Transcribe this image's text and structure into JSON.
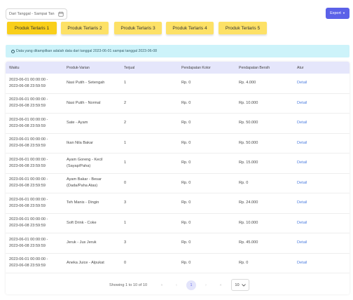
{
  "filter": {
    "placeholder": "Dari Tanggal - Sampai Tan"
  },
  "export": {
    "label": "Export"
  },
  "tabs": [
    {
      "label": "Produk Terlaris 1"
    },
    {
      "label": "Produk Terlaris 2"
    },
    {
      "label": "Produk Terlaris 3"
    },
    {
      "label": "Produk Terlaris 4"
    },
    {
      "label": "Produk Terlaris 5"
    }
  ],
  "info": {
    "text": "Data yang ditampilkan adalah data dari tanggal 2023-06-01 sampai tanggal 2023-06-08"
  },
  "table": {
    "headers": [
      "Waktu",
      "Produk-Varian",
      "Terjual",
      "Pendapatan Kotor",
      "Pendapatan Bersih",
      "Atur"
    ],
    "rows": [
      {
        "time_from": "2023-06-01 00:00:00 -",
        "time_to": "2023-06-08 23:59:59",
        "product": "Nasi Putih - Setengah",
        "product_2": "",
        "sold": "1",
        "gross": "Rp. 0",
        "net": "Rp. 4.000",
        "action": "Detail"
      },
      {
        "time_from": "2023-06-01 00:00:00 -",
        "time_to": "2023-06-08 23:59:59",
        "product": "Nasi Putih - Normal",
        "product_2": "",
        "sold": "2",
        "gross": "Rp. 0",
        "net": "Rp. 10.000",
        "action": "Detail"
      },
      {
        "time_from": "2023-06-01 00:00:00 -",
        "time_to": "2023-06-08 23:59:59",
        "product": "Sate - Ayam",
        "product_2": "",
        "sold": "2",
        "gross": "Rp. 0",
        "net": "Rp. 50.000",
        "action": "Detail"
      },
      {
        "time_from": "2023-06-01 00:00:00 -",
        "time_to": "2023-06-08 23:59:59",
        "product": "Ikan Nila Bakar",
        "product_2": "",
        "sold": "1",
        "gross": "Rp. 0",
        "net": "Rp. 50.000",
        "action": "Detail"
      },
      {
        "time_from": "2023-06-01 00:00:00 -",
        "time_to": "2023-06-08 23:59:59",
        "product": "Ayam Goreng - Kecil",
        "product_2": "(Sayap/Paha)",
        "sold": "1",
        "gross": "Rp. 0",
        "net": "Rp. 15.000",
        "action": "Detail"
      },
      {
        "time_from": "2023-06-01 00:00:00 -",
        "time_to": "2023-06-08 23:59:59",
        "product": "Ayam Bakar - Besar",
        "product_2": "(Dada/Paha Atas)",
        "sold": "0",
        "gross": "Rp. 0",
        "net": "Rp. 0",
        "action": "Detail"
      },
      {
        "time_from": "2023-06-01 00:00:00 -",
        "time_to": "2023-06-08 23:59:59",
        "product": "Teh Manis - Dingin",
        "product_2": "",
        "sold": "3",
        "gross": "Rp. 0",
        "net": "Rp. 24.000",
        "action": "Detail"
      },
      {
        "time_from": "2023-06-01 00:00:00 -",
        "time_to": "2023-06-08 23:59:59",
        "product": "Soft Drink - Coke",
        "product_2": "",
        "sold": "1",
        "gross": "Rp. 0",
        "net": "Rp. 10.000",
        "action": "Detail"
      },
      {
        "time_from": "2023-06-01 00:00:00 -",
        "time_to": "2023-06-08 23:59:59",
        "product": "Jeruk - Jus Jeruk",
        "product_2": "",
        "sold": "3",
        "gross": "Rp. 0",
        "net": "Rp. 45.000",
        "action": "Detail"
      },
      {
        "time_from": "2023-06-01 00:00:00 -",
        "time_to": "2023-06-08 23:59:59",
        "product": "Aneka Juice - Alpukat",
        "product_2": "",
        "sold": "0",
        "gross": "Rp. 0",
        "net": "Rp. 0",
        "action": "Detail"
      }
    ]
  },
  "pagination": {
    "summary": "Showing 1 to 10 of 10",
    "first": "«",
    "prev": "‹",
    "page": "1",
    "next": "›",
    "last": "»",
    "per_page": "10"
  },
  "colors": {
    "accent": "#5b61e8",
    "tab": "#fde166",
    "tab_active": "#f9cf1a",
    "banner": "#cdf3fa",
    "link": "#4f7fe0"
  },
  "icons": {
    "filter": "calendar-icon",
    "banner": "info-icon",
    "per_page": "chevron-down-icon"
  }
}
